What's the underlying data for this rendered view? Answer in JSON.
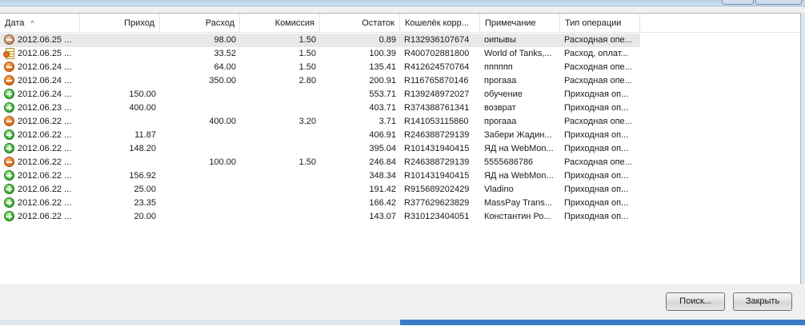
{
  "columns": [
    {
      "label": "Дата",
      "sort": "^"
    },
    {
      "label": "Приход"
    },
    {
      "label": "Расход"
    },
    {
      "label": "Комиссия"
    },
    {
      "label": "Остаток"
    },
    {
      "label": "Кошелёк корр..."
    },
    {
      "label": "Примечание"
    },
    {
      "label": "Тип операции"
    }
  ],
  "rows": [
    {
      "icon": "expense-gray-icon",
      "date": "2012.06.25 ...",
      "income": "",
      "expense": "98.00",
      "fee": "1.50",
      "balance": "0.89",
      "wallet": "R132936107674",
      "note": "оипывы",
      "type": "Расходная опе..."
    },
    {
      "icon": "invoice-payment-icon",
      "date": "2012.06.25 ...",
      "income": "",
      "expense": "33.52",
      "fee": "1.50",
      "balance": "100.39",
      "wallet": "R400702881800",
      "note": "World of Tanks,...",
      "type": "Расход, оплат..."
    },
    {
      "icon": "expense-icon",
      "date": "2012.06.24 ...",
      "income": "",
      "expense": "64.00",
      "fee": "1.50",
      "balance": "135.41",
      "wallet": "R412624570764",
      "note": "пппппп",
      "type": "Расходная опе..."
    },
    {
      "icon": "expense-icon",
      "date": "2012.06.24 ...",
      "income": "",
      "expense": "350.00",
      "fee": "2.80",
      "balance": "200.91",
      "wallet": "R116765870146",
      "note": "прогааа",
      "type": "Расходная опе..."
    },
    {
      "icon": "income-icon",
      "date": "2012.06.24 ...",
      "income": "150.00",
      "expense": "",
      "fee": "",
      "balance": "553.71",
      "wallet": "R139248972027",
      "note": "обучение",
      "type": "Приходная оп..."
    },
    {
      "icon": "income-icon",
      "date": "2012.06.23 ...",
      "income": "400.00",
      "expense": "",
      "fee": "",
      "balance": "403.71",
      "wallet": "R374388761341",
      "note": "возврат",
      "type": "Приходная оп..."
    },
    {
      "icon": "expense-icon",
      "date": "2012.06.22 ...",
      "income": "",
      "expense": "400.00",
      "fee": "3.20",
      "balance": "3.71",
      "wallet": "R141053115860",
      "note": "прогааа",
      "type": "Расходная опе..."
    },
    {
      "icon": "income-icon",
      "date": "2012.06.22 ...",
      "income": "11.87",
      "expense": "",
      "fee": "",
      "balance": "406.91",
      "wallet": "R246388729139",
      "note": "Забери Жадин...",
      "type": "Приходная оп..."
    },
    {
      "icon": "income-icon",
      "date": "2012.06.22 ...",
      "income": "148.20",
      "expense": "",
      "fee": "",
      "balance": "395.04",
      "wallet": "R101431940415",
      "note": "ЯД на WebMon...",
      "type": "Приходная оп..."
    },
    {
      "icon": "expense-icon",
      "date": "2012.06.22 ...",
      "income": "",
      "expense": "100.00",
      "fee": "1.50",
      "balance": "246.84",
      "wallet": "R246388729139",
      "note": "5555686786",
      "type": "Расходная опе..."
    },
    {
      "icon": "income-icon",
      "date": "2012.06.22 ...",
      "income": "156.92",
      "expense": "",
      "fee": "",
      "balance": "348.34",
      "wallet": "R101431940415",
      "note": "ЯД на WebMon...",
      "type": "Приходная оп..."
    },
    {
      "icon": "income-icon",
      "date": "2012.06.22 ...",
      "income": "25.00",
      "expense": "",
      "fee": "",
      "balance": "191.42",
      "wallet": "R915689202429",
      "note": "Vladino",
      "type": "Приходная оп..."
    },
    {
      "icon": "income-icon",
      "date": "2012.06.22 ...",
      "income": "23.35",
      "expense": "",
      "fee": "",
      "balance": "166.42",
      "wallet": "R377629623829",
      "note": "MassPay Trans...",
      "type": "Приходная оп..."
    },
    {
      "icon": "income-icon",
      "date": "2012.06.22 ...",
      "income": "20.00",
      "expense": "",
      "fee": "",
      "balance": "143.07",
      "wallet": "R310123404051",
      "note": "Константин Ро...",
      "type": "Приходная оп..."
    }
  ],
  "buttons": {
    "search": "Поиск...",
    "close": "Закрыть"
  }
}
